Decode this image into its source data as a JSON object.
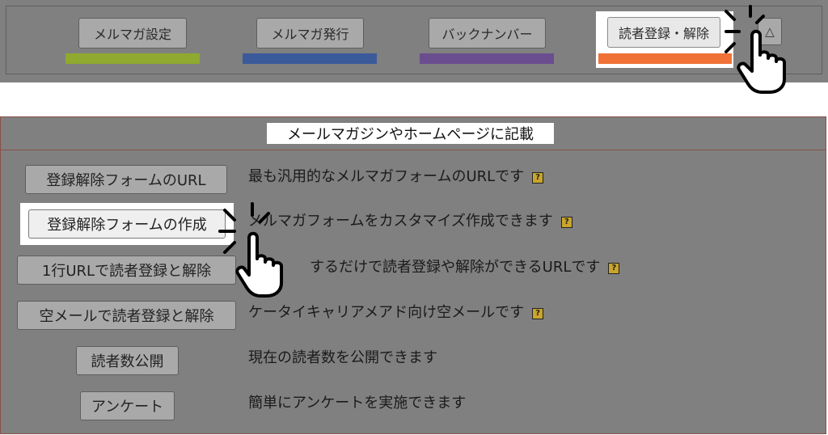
{
  "tabs": [
    {
      "label": "メルマガ設定",
      "bar_color": "#8faa2e"
    },
    {
      "label": "メルマガ発行",
      "bar_color": "#3b5a9a"
    },
    {
      "label": "バックナンバー",
      "bar_color": "#6a4d8f"
    },
    {
      "label": "読者登録・解除",
      "bar_color": "#f07236",
      "active": true
    }
  ],
  "collapse_button": {
    "label": "△"
  },
  "panel": {
    "title": "メールマガジンやホームページに記載",
    "rows": [
      {
        "button": "登録解除フォームのURL",
        "description": "最も汎用的なメルマガフォームのURLです",
        "help": true
      },
      {
        "button": "登録解除フォームの作成",
        "description": "メルマガフォームをカスタマイズ作成できます",
        "help": true,
        "active": true
      },
      {
        "button": "1行URLで読者登録と解除",
        "description": "するだけで読者登録や解除ができるURLです",
        "help": true
      },
      {
        "button": "空メールで読者登録と解除",
        "description": "ケータイキャリアメアド向け空メールです",
        "help": true
      },
      {
        "button": "読者数公開",
        "description": "現在の読者数を公開できます",
        "help": false
      },
      {
        "button": "アンケート",
        "description": "簡単にアンケートを実施できます",
        "help": false
      }
    ]
  },
  "icons": {
    "help": "?"
  }
}
